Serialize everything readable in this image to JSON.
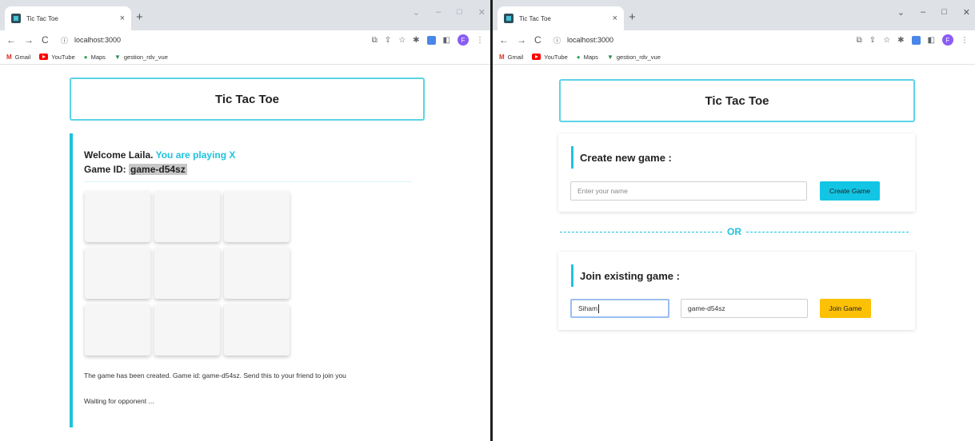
{
  "windows": [
    {
      "tab_title": "Tic Tac Toe",
      "url": "localhost:3000",
      "bookmarks": [
        "Gmail",
        "YouTube",
        "Maps",
        "gestion_rdv_vue"
      ],
      "app_title": "Tic Tac Toe",
      "welcome_prefix": "Welcome Laila.",
      "welcome_role": "You are playing X",
      "game_id_label": "Game ID:",
      "game_id_value": "game-d54sz",
      "board_cells": [
        "",
        "",
        "",
        "",
        "",
        "",
        "",
        "",
        ""
      ],
      "status_message": "The game has been created. Game id: game-d54sz. Send this to your friend to join you",
      "waiting_message": "Waiting for opponent ..."
    },
    {
      "tab_title": "Tic Tac Toe",
      "url": "localhost:3000",
      "bookmarks": [
        "Gmail",
        "YouTube",
        "Maps",
        "gestion_rdv_vue"
      ],
      "app_title": "Tic Tac Toe",
      "create_title": "Create new game :",
      "create_name_placeholder": "Enter your name",
      "create_button": "Create Game",
      "or_label": "OR",
      "join_title": "Join existing game :",
      "join_name_value": "Siham",
      "join_game_id_value": "game-d54sz",
      "join_button": "Join Game"
    }
  ],
  "icons": {
    "back": "←",
    "forward": "→",
    "reload": "C",
    "info": "ⓘ",
    "close": "×",
    "new_tab": "+",
    "minimize": "–",
    "maximize": "□",
    "win_close": "✕",
    "tab_search": "⌄",
    "translate": "⧉",
    "share": "⇪",
    "star": "☆",
    "puzzle": "✱",
    "menu": "⋮",
    "sidepanel": "◧",
    "avatar_letter": "F"
  },
  "colors": {
    "accent": "#1fc2df",
    "create_button": "#13c5e4",
    "join_button": "#fcc107"
  }
}
